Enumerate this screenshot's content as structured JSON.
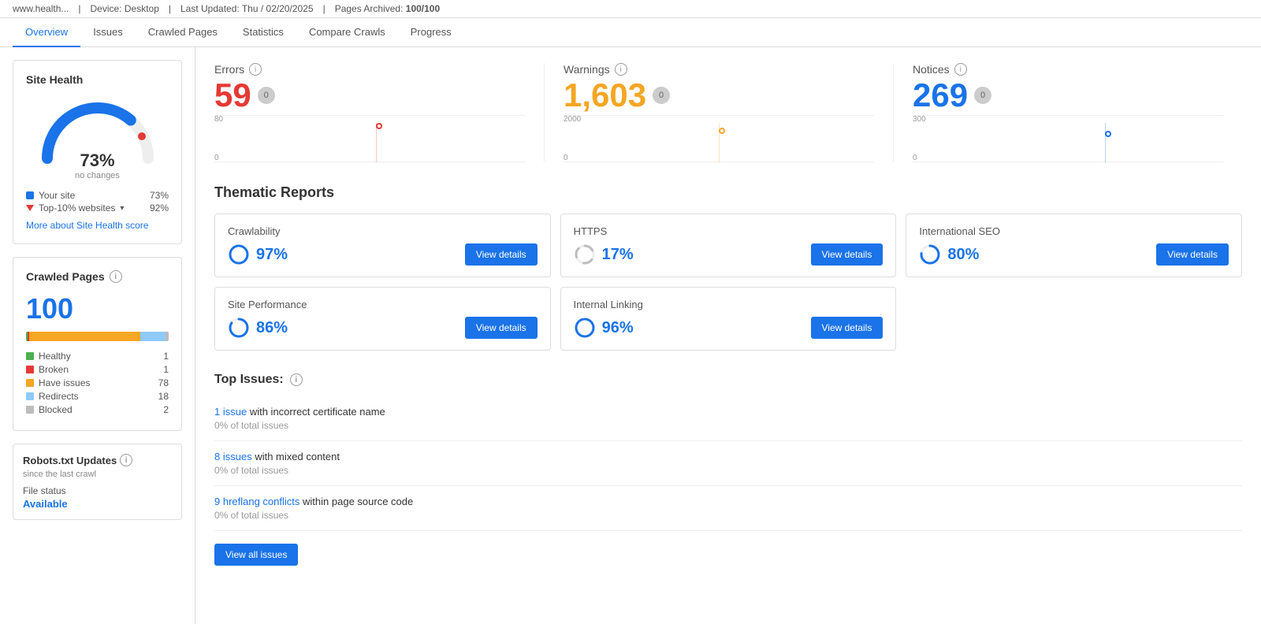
{
  "topbar": {
    "domain": "www.health...",
    "device": "Device: Desktop",
    "lastUpdated": "Last Updated: Thu / 02/20/2025",
    "pages": "Pages Archived:",
    "pagesCount": "100/100"
  },
  "tabs": [
    {
      "id": "overview",
      "label": "Overview",
      "active": true
    },
    {
      "id": "issues",
      "label": "Issues",
      "active": false
    },
    {
      "id": "crawled",
      "label": "Crawled Pages",
      "active": false
    },
    {
      "id": "statistics",
      "label": "Statistics",
      "active": false
    },
    {
      "id": "compare",
      "label": "Compare Crawls",
      "active": false
    },
    {
      "id": "progress",
      "label": "Progress",
      "active": false
    }
  ],
  "siteHealth": {
    "title": "Site Health",
    "percent": "73%",
    "sub": "no changes",
    "yourSiteLabel": "Your site",
    "yourSiteValue": "73%",
    "top10Label": "Top-10% websites",
    "top10Value": "92%",
    "moreLink": "More about Site Health score"
  },
  "crawledPages": {
    "title": "Crawled Pages",
    "count": "100",
    "bars": [
      {
        "color": "#4caf50",
        "width": 1,
        "label": "Healthy",
        "count": "1"
      },
      {
        "color": "#e53935",
        "width": 1,
        "label": "Broken",
        "count": "1"
      },
      {
        "color": "#f5a623",
        "width": 78,
        "label": "Have issues",
        "count": "78"
      },
      {
        "color": "#90caf9",
        "width": 18,
        "label": "Redirects",
        "count": "18"
      },
      {
        "color": "#bdbdbd",
        "width": 2,
        "label": "Blocked",
        "count": "2"
      }
    ]
  },
  "robotsTxt": {
    "title": "Robots.txt Updates",
    "sub": "since the last crawl",
    "fileStatusLabel": "File status",
    "fileStatusValue": "Available"
  },
  "metrics": {
    "errors": {
      "label": "Errors",
      "value": "59",
      "badge": "0",
      "chartMax": "80",
      "chartMin": "0",
      "color": "red",
      "dotColor": "#e53935"
    },
    "warnings": {
      "label": "Warnings",
      "value": "1,603",
      "badge": "0",
      "chartMax": "2000",
      "chartMin": "0",
      "color": "orange",
      "dotColor": "#f5a623"
    },
    "notices": {
      "label": "Notices",
      "value": "269",
      "badge": "0",
      "chartMax": "300",
      "chartMin": "0",
      "color": "blue",
      "dotColor": "#1a73e8"
    }
  },
  "thematicReports": {
    "title": "Thematic Reports",
    "reports": [
      {
        "id": "crawlability",
        "title": "Crawlability",
        "value": "97%",
        "color": "#1a73e8"
      },
      {
        "id": "https",
        "title": "HTTPS",
        "value": "17%",
        "color": "#bdbdbd"
      },
      {
        "id": "international-seo",
        "title": "International SEO",
        "value": "80%",
        "color": "#1a73e8"
      },
      {
        "id": "site-performance",
        "title": "Site Performance",
        "value": "86%",
        "color": "#1a73e8"
      },
      {
        "id": "internal-linking",
        "title": "Internal Linking",
        "value": "96%",
        "color": "#1a73e8"
      }
    ],
    "viewDetailsLabel": "View details"
  },
  "topIssues": {
    "title": "Top Issues:",
    "issues": [
      {
        "id": "issue-1",
        "linkText": "1 issue",
        "restText": " with incorrect certificate name",
        "sub": "0% of total issues"
      },
      {
        "id": "issue-2",
        "linkText": "8 issues",
        "restText": " with mixed content",
        "sub": "0% of total issues"
      },
      {
        "id": "issue-3",
        "linkText": "9 hreflang conflicts",
        "restText": " within page source code",
        "sub": "0% of total issues"
      }
    ],
    "viewAllLabel": "View all issues"
  }
}
